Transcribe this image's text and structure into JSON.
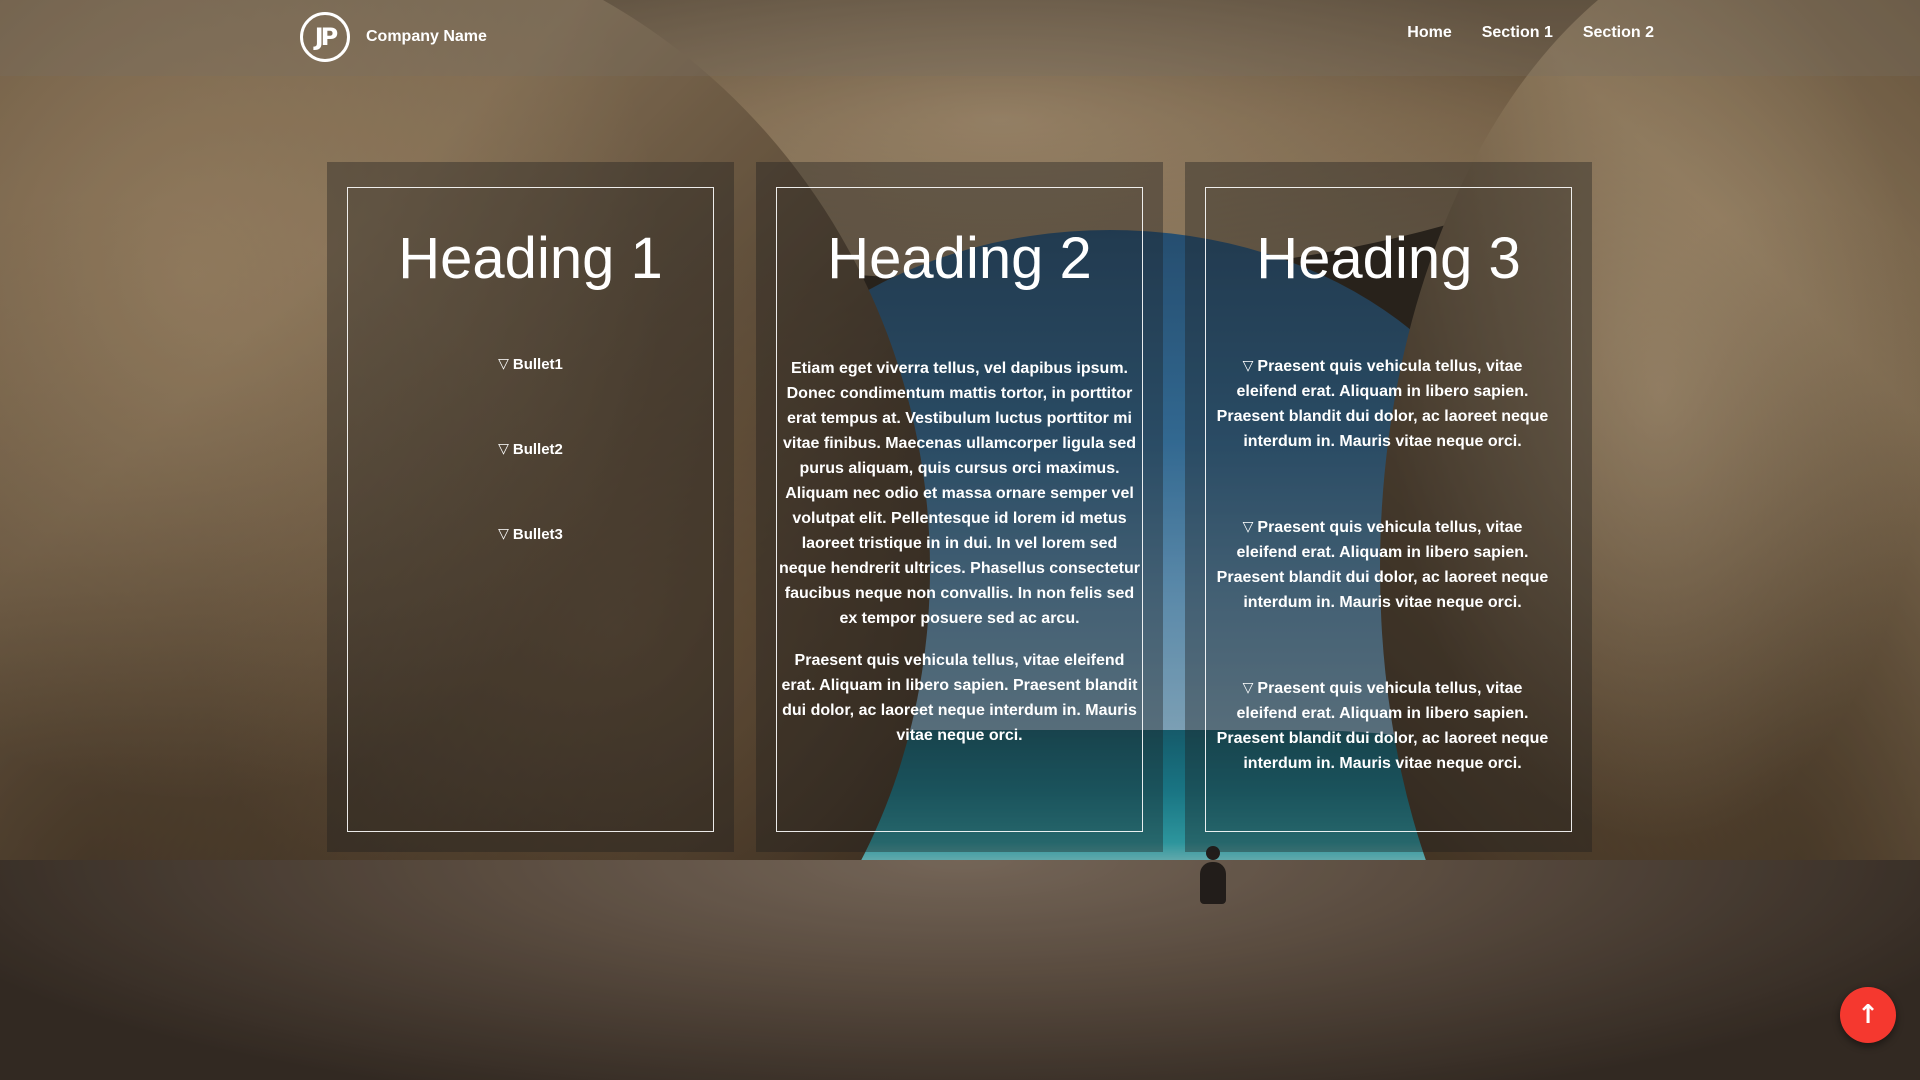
{
  "header": {
    "logo_text": "JP",
    "company_name": "Company Name",
    "nav": [
      {
        "label": "Home"
      },
      {
        "label": "Section 1"
      },
      {
        "label": "Section 2"
      }
    ]
  },
  "panels": [
    {
      "heading": "Heading 1",
      "bullets": [
        "Bullet1",
        "Bullet2",
        "Bullet3"
      ]
    },
    {
      "heading": "Heading 2",
      "paragraphs": [
        "Etiam eget viverra tellus, vel dapibus ipsum. Donec condimentum mattis tortor, in porttitor erat tempus at. Vestibulum luctus porttitor mi vitae finibus. Maecenas ullamcorper ligula sed purus aliquam, quis cursus orci maximus. Aliquam nec odio et massa ornare semper vel volutpat elit. Pellentesque id lorem id metus laoreet tristique in in dui. In vel lorem sed neque hendrerit ultrices. Phasellus consectetur faucibus neque non convallis. In non felis sed ex tempor posuere sed ac arcu.",
        "Praesent quis vehicula tellus, vitae eleifend erat. Aliquam in libero sapien. Praesent blandit dui dolor, ac laoreet neque interdum in. Mauris vitae neque orci."
      ]
    },
    {
      "heading": "Heading 3",
      "bullets": [
        "Praesent quis vehicula tellus, vitae eleifend erat. Aliquam in libero sapien. Praesent blandit dui dolor, ac laoreet neque interdum in. Mauris vitae neque orci.",
        "Praesent quis vehicula tellus, vitae eleifend erat. Aliquam in libero sapien. Praesent blandit dui dolor, ac laoreet neque interdum in. Mauris vitae neque orci.",
        "Praesent quis vehicula tellus, vitae eleifend erat. Aliquam in libero sapien. Praesent blandit dui dolor, ac laoreet neque interdum in. Mauris vitae neque orci."
      ]
    }
  ],
  "bullet_icon": "triangle-down-icon",
  "scroll_top": {
    "icon": "arrow-up-icon",
    "color": "#f5382f",
    "glyph": "↑"
  },
  "bullet_glyph": "▽"
}
